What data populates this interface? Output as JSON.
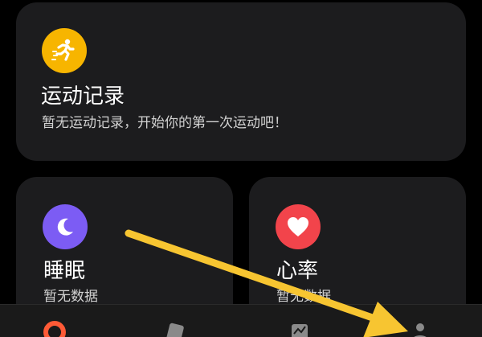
{
  "cards": {
    "exercise": {
      "icon": "running-icon",
      "icon_color": "#f7b500",
      "title": "运动记录",
      "subtitle": "暂无运动记录，开始你的第一次运动吧！"
    },
    "sleep": {
      "icon": "moon-icon",
      "icon_color": "#7c5cf4",
      "title": "睡眠",
      "subtitle": "暂无数据"
    },
    "heart": {
      "icon": "heart-icon",
      "icon_color": "#f2444b",
      "title": "心率",
      "subtitle": "暂无数据"
    }
  },
  "tabbar": {
    "items": [
      {
        "icon": "ring-icon",
        "active": true,
        "color": "#ff5a36"
      },
      {
        "icon": "device-icon",
        "active": false,
        "color": "#8a8a8a"
      },
      {
        "icon": "chart-icon",
        "active": false,
        "color": "#8a8a8a"
      },
      {
        "icon": "profile-icon",
        "active": false,
        "color": "#8a8a8a"
      }
    ]
  },
  "annotation": {
    "arrow_color": "#f7c531",
    "arrow_icon": "arrow-annotation"
  }
}
